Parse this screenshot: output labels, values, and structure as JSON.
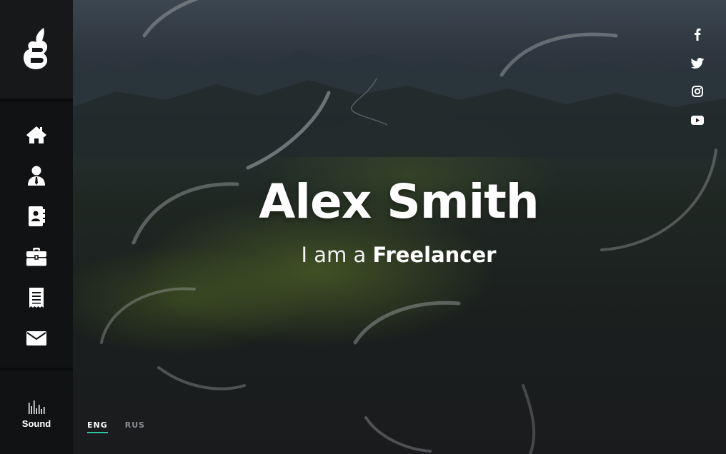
{
  "hero": {
    "name": "Alex Smith",
    "subtitle_prefix": "I am a",
    "subtitle_role": "Freelancer"
  },
  "sidebar": {
    "logo": "logo-icon",
    "items": [
      {
        "icon": "home-icon"
      },
      {
        "icon": "user-icon"
      },
      {
        "icon": "contact-book-icon"
      },
      {
        "icon": "briefcase-icon"
      },
      {
        "icon": "receipt-icon"
      },
      {
        "icon": "envelope-icon"
      }
    ],
    "sound_label": "Sound"
  },
  "social": [
    "facebook-icon",
    "twitter-icon",
    "instagram-icon",
    "youtube-icon"
  ],
  "languages": [
    {
      "label": "ENG",
      "active": true
    },
    {
      "label": "RUS",
      "active": false
    }
  ],
  "colors": {
    "accent": "#2ec4a0",
    "sidebar": "#111214",
    "text": "#ffffff"
  }
}
